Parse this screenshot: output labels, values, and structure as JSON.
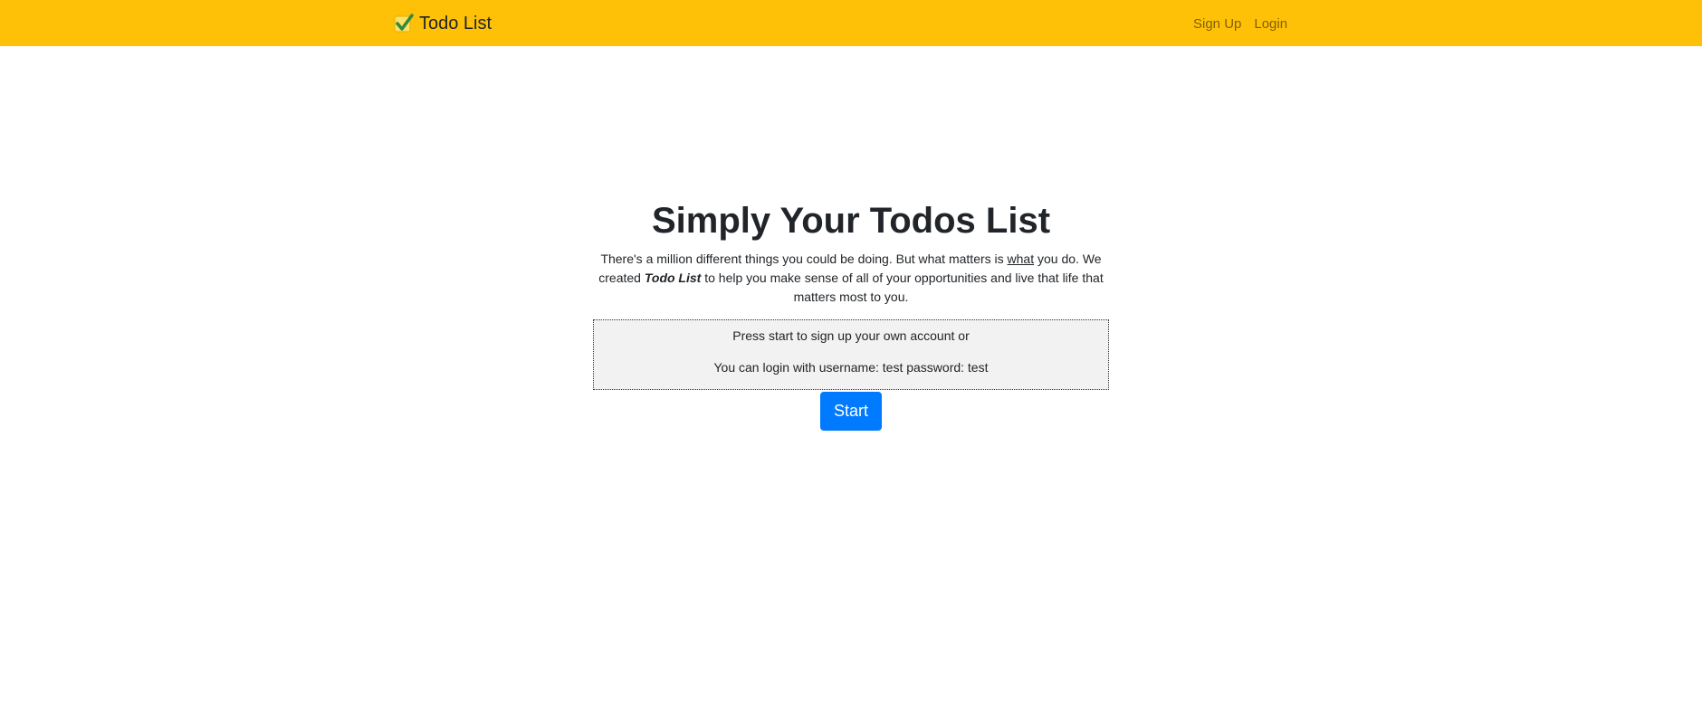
{
  "navbar": {
    "brand_label": "Todo List",
    "brand_icon": "check-mark-icon",
    "colors": {
      "background": "#ffc107",
      "check": "#2e8b3a",
      "check_box": "#ffe066"
    },
    "links": [
      {
        "label": "Sign Up"
      },
      {
        "label": "Login"
      }
    ]
  },
  "hero": {
    "title": "Simply Your Todos List",
    "desc_part1": "There's a million different things you could be doing. But what matters is ",
    "desc_underlined": "what",
    "desc_part2": " you do. We created ",
    "desc_emphasis": "Todo List",
    "desc_part3": " to help you make sense of all of your opportunities and live that life that matters most to you."
  },
  "info_box": {
    "line1": "Press start to sign up your own account or",
    "line2": "You can login with username: test password: test"
  },
  "start_button": {
    "label": "Start",
    "color": "#007bff"
  }
}
